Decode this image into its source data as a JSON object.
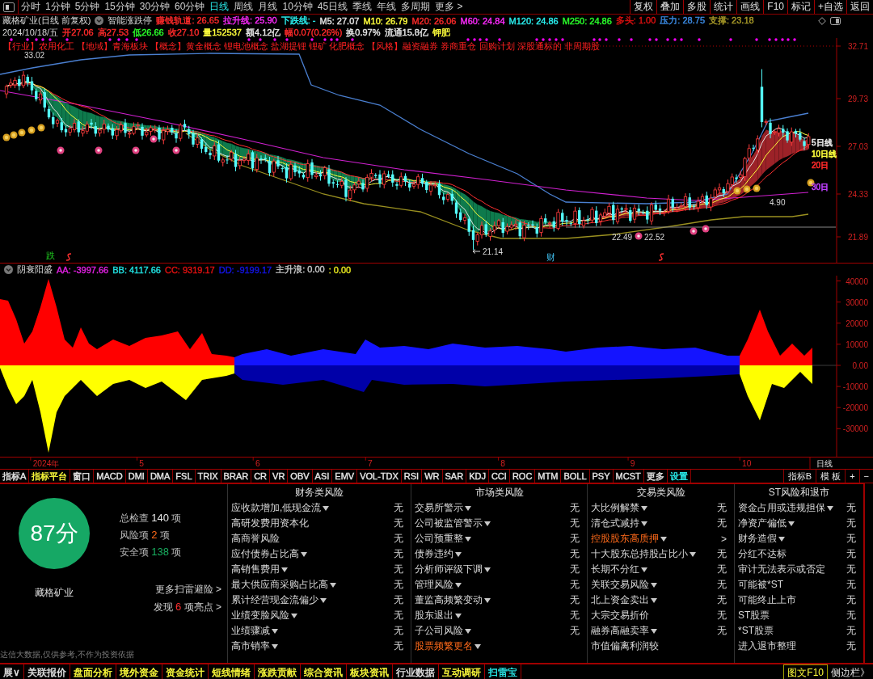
{
  "toolbar": {
    "periods": [
      {
        "label": "分时",
        "selected": false
      },
      {
        "label": "1分钟",
        "selected": false
      },
      {
        "label": "5分钟",
        "selected": false
      },
      {
        "label": "15分钟",
        "selected": false
      },
      {
        "label": "30分钟",
        "selected": false
      },
      {
        "label": "60分钟",
        "selected": false
      },
      {
        "label": "日线",
        "selected": true
      },
      {
        "label": "周线",
        "selected": false
      },
      {
        "label": "月线",
        "selected": false
      },
      {
        "label": "10分钟",
        "selected": false
      },
      {
        "label": "45日线",
        "selected": false
      },
      {
        "label": "季线",
        "selected": false
      },
      {
        "label": "年线",
        "selected": false
      },
      {
        "label": "多周期",
        "selected": false
      },
      {
        "label": "更多 >",
        "selected": false
      }
    ],
    "buttons": [
      "复权",
      "叠加",
      "多股",
      "统计",
      "画线",
      "F10",
      "标记",
      "+自选",
      "返回"
    ]
  },
  "title_line": {
    "stock": "藏格矿业(日线 前复权)",
    "indicator": "智能涨跌停",
    "values": [
      {
        "text": "赚钱轨道: 26.65",
        "color": "#ff2a2a"
      },
      {
        "text": "拉升线: 25.90",
        "color": "#ff2aff"
      },
      {
        "text": "下跌线: -",
        "color": "#2af0f0"
      },
      {
        "text": "M5: 27.07",
        "color": "#e6e6e6"
      },
      {
        "text": "M10: 26.79",
        "color": "#ffff3c"
      },
      {
        "text": "M20: 26.06",
        "color": "#ff2a2a"
      },
      {
        "text": "M60: 24.84",
        "color": "#ff2aff"
      },
      {
        "text": "M120: 24.86",
        "color": "#2af0f0"
      },
      {
        "text": "M250: 24.86",
        "color": "#2aff2a"
      },
      {
        "text": "多头: 1.00",
        "color": "#e01010"
      },
      {
        "text": "压力: 28.75",
        "color": "#3c8ce6"
      },
      {
        "text": "支撑: 23.18",
        "color": "#a89a28"
      }
    ]
  },
  "quote_line": {
    "date": "2024/10/18/五",
    "values": [
      {
        "text": "开27.06",
        "color": "#ff2a2a"
      },
      {
        "text": "高27.53",
        "color": "#ff2a2a"
      },
      {
        "text": "低26.66",
        "color": "#2aff2a"
      },
      {
        "text": "收27.10",
        "color": "#ff2a2a"
      },
      {
        "text": "量152537",
        "color": "#ffff3c"
      },
      {
        "text": "额4.12亿",
        "color": "#e6e6e6"
      },
      {
        "text": "幅0.07(0.26%)",
        "color": "#ff2a2a"
      },
      {
        "text": "换0.97%",
        "color": "#e6e6e6"
      },
      {
        "text": "流通15.8亿",
        "color": "#e6e6e6"
      },
      {
        "text": "钾肥",
        "color": "#ffff3c"
      }
    ]
  },
  "concept_line": "【行业】农用化工 【地域】青海板块 【概念】黄金概念 锂电池概念 盐湖提锂 锂矿 化肥概念 【风格】融资融券 券商重仓 回购计划 深股通标的 非周期股",
  "main_chart": {
    "price_axis": [
      "32.71",
      "29.73",
      "27.03",
      "24.33",
      "21.89"
    ],
    "price_marks": [
      "33.02",
      "21.14",
      "22.49",
      "22.52",
      "4.90"
    ],
    "ma_labels": [
      {
        "text": "5日线",
        "color": "#e6e6e6"
      },
      {
        "text": "10日线",
        "color": "#ffff3c"
      },
      {
        "text": "20日",
        "color": "#ff2a2a"
      },
      {
        "text": "30日",
        "color": "#c040ff"
      }
    ],
    "event_marks": [
      "跌",
      "财"
    ]
  },
  "indicator": {
    "name": "阴衰阳盛",
    "values": [
      {
        "text": "AA: -3997.66",
        "color": "#e020e0"
      },
      {
        "text": "BB: 4117.66",
        "color": "#20e0e0"
      },
      {
        "text": "CC: 9319.17",
        "color": "#e01010"
      },
      {
        "text": "DD: -9199.17",
        "color": "#1414e6"
      },
      {
        "text": "主升浪: 0.00",
        "color": "#c8c8c8"
      },
      {
        "text": ": 0.00",
        "color": "#e6e61e"
      }
    ],
    "axis": [
      "40000",
      "30000",
      "20000",
      "10000",
      "0.00",
      "-10000",
      "-20000",
      "-30000"
    ]
  },
  "date_axis": {
    "labels": [
      "2024年",
      "5",
      "6",
      "7",
      "8",
      "9",
      "10"
    ],
    "period": "日线"
  },
  "indicator_tabs": [
    {
      "label": "指标A",
      "color": "#e6e6e6"
    },
    {
      "label": "指标平台",
      "color": "#ffff3c"
    },
    {
      "label": "窗口",
      "color": "#e6e6e6"
    },
    {
      "label": "MACD",
      "color": "#e6e6e6"
    },
    {
      "label": "DMI",
      "color": "#e6e6e6"
    },
    {
      "label": "DMA",
      "color": "#e6e6e6"
    },
    {
      "label": "FSL",
      "color": "#e6e6e6"
    },
    {
      "label": "TRIX",
      "color": "#e6e6e6"
    },
    {
      "label": "BRAR",
      "color": "#e6e6e6"
    },
    {
      "label": "CR",
      "color": "#e6e6e6"
    },
    {
      "label": "VR",
      "color": "#e6e6e6"
    },
    {
      "label": "OBV",
      "color": "#e6e6e6"
    },
    {
      "label": "ASI",
      "color": "#e6e6e6"
    },
    {
      "label": "EMV",
      "color": "#e6e6e6"
    },
    {
      "label": "VOL-TDX",
      "color": "#e6e6e6"
    },
    {
      "label": "RSI",
      "color": "#e6e6e6"
    },
    {
      "label": "WR",
      "color": "#e6e6e6"
    },
    {
      "label": "SAR",
      "color": "#e6e6e6"
    },
    {
      "label": "KDJ",
      "color": "#e6e6e6"
    },
    {
      "label": "CCI",
      "color": "#e6e6e6"
    },
    {
      "label": "ROC",
      "color": "#e6e6e6"
    },
    {
      "label": "MTM",
      "color": "#e6e6e6"
    },
    {
      "label": "BOLL",
      "color": "#e6e6e6"
    },
    {
      "label": "PSY",
      "color": "#e6e6e6"
    },
    {
      "label": "MCST",
      "color": "#e6e6e6"
    },
    {
      "label": "更多",
      "color": "#e6e6e6"
    },
    {
      "label": "设置",
      "color": "#2af0f0"
    }
  ],
  "indicator_tools": [
    "指标B",
    "模 板",
    "+",
    "−"
  ],
  "scan_panel": {
    "score": "87分",
    "stock": "藏格矿业",
    "stats": [
      {
        "label": "总检查",
        "count": "140",
        "unit": "项",
        "kind": "total"
      },
      {
        "label": "风险项",
        "count": "2",
        "unit": "项",
        "kind": "risk"
      },
      {
        "label": "安全项",
        "count": "138",
        "unit": "项",
        "kind": "safe"
      }
    ],
    "more_link": "更多扫雷避险 >",
    "highlights": {
      "prefix": "发现",
      "count": "6",
      "suffix": "项亮点 >"
    },
    "disclaimer": "达信大数据,仅供参考,不作为投资依据",
    "columns": [
      {
        "title": "财务类风险",
        "rows": [
          {
            "name": "应收款增加,低现金流",
            "dropdown": true,
            "risk": false,
            "result": "无"
          },
          {
            "name": "高研发费用资本化",
            "dropdown": false,
            "risk": false,
            "result": "无"
          },
          {
            "name": "高商誉风险",
            "dropdown": false,
            "risk": false,
            "result": "无"
          },
          {
            "name": "应付债券占比高",
            "dropdown": true,
            "risk": false,
            "result": "无"
          },
          {
            "name": "高销售费用",
            "dropdown": true,
            "risk": false,
            "result": "无"
          },
          {
            "name": "最大供应商采购占比高",
            "dropdown": true,
            "risk": false,
            "result": "无"
          },
          {
            "name": "累计经营现金流偏少",
            "dropdown": true,
            "risk": false,
            "result": "无"
          },
          {
            "name": "业绩变脸风险",
            "dropdown": true,
            "risk": false,
            "result": "无"
          },
          {
            "name": "业绩骤减",
            "dropdown": true,
            "risk": false,
            "result": "无"
          },
          {
            "name": "高市销率",
            "dropdown": true,
            "risk": false,
            "result": "无"
          }
        ]
      },
      {
        "title": "市场类风险",
        "rows": [
          {
            "name": "交易所警示",
            "dropdown": true,
            "risk": false,
            "result": "无"
          },
          {
            "name": "公司被监管警示",
            "dropdown": true,
            "risk": false,
            "result": "无"
          },
          {
            "name": "公司预重整",
            "dropdown": true,
            "risk": false,
            "result": "无"
          },
          {
            "name": "债券违约",
            "dropdown": true,
            "risk": false,
            "result": "无"
          },
          {
            "name": "分析师评级下调",
            "dropdown": true,
            "risk": false,
            "result": "无"
          },
          {
            "name": "管理风险",
            "dropdown": true,
            "risk": false,
            "result": "无"
          },
          {
            "name": "董监高频繁变动",
            "dropdown": true,
            "risk": false,
            "result": "无"
          },
          {
            "name": "股东退出",
            "dropdown": true,
            "risk": false,
            "result": "无"
          },
          {
            "name": "子公司风险",
            "dropdown": true,
            "risk": false,
            "result": "无"
          },
          {
            "name": "股票频繁更名",
            "dropdown": true,
            "risk": true
          }
        ]
      },
      {
        "title": "交易类风险",
        "rows": [
          {
            "name": "大比例解禁",
            "dropdown": true,
            "risk": false,
            "result": "无"
          },
          {
            "name": "清仓式减持",
            "dropdown": true,
            "risk": false,
            "result": "无"
          },
          {
            "name": "控股股东高质押",
            "dropdown": true,
            "risk": true,
            "result": ">"
          },
          {
            "name": "十大股东总持股占比小",
            "dropdown": true,
            "risk": false,
            "result": "无"
          },
          {
            "name": "长期不分红",
            "dropdown": true,
            "risk": false,
            "result": "无"
          },
          {
            "name": "关联交易风险",
            "dropdown": true,
            "risk": false,
            "result": "无"
          },
          {
            "name": "北上资金卖出",
            "dropdown": true,
            "risk": false,
            "result": "无"
          },
          {
            "name": "大宗交易折价",
            "dropdown": false,
            "risk": false,
            "result": "无"
          },
          {
            "name": "融券高融卖率",
            "dropdown": true,
            "risk": false,
            "result": "无"
          },
          {
            "name": "市值偏离利润较",
            "dropdown": false,
            "risk": false
          }
        ]
      },
      {
        "title": "ST风险和退市",
        "rows": [
          {
            "name": "资金占用或违规担保",
            "dropdown": true,
            "risk": false,
            "result": "无"
          },
          {
            "name": "净资产偏低",
            "dropdown": true,
            "risk": false,
            "result": "无"
          },
          {
            "name": "财务造假",
            "dropdown": true,
            "risk": false,
            "result": "无"
          },
          {
            "name": "分红不达标",
            "dropdown": false,
            "risk": false,
            "result": "无"
          },
          {
            "name": "审计无法表示或否定",
            "dropdown": false,
            "risk": false,
            "result": "无"
          },
          {
            "name": "可能被*ST",
            "dropdown": false,
            "risk": false,
            "result": "无"
          },
          {
            "name": "可能终止上市",
            "dropdown": false,
            "risk": false,
            "result": "无"
          },
          {
            "name": "ST股票",
            "dropdown": false,
            "risk": false,
            "result": "无"
          },
          {
            "name": "*ST股票",
            "dropdown": false,
            "risk": false,
            "result": "无"
          },
          {
            "name": "进入退市整理",
            "dropdown": false,
            "risk": false,
            "result": "无"
          }
        ]
      }
    ]
  },
  "bottom_tabs": [
    {
      "label": "展∨",
      "color": "#e6e6e6",
      "selected": false
    },
    {
      "label": "关联报价",
      "color": "#e6e6e6",
      "selected": false
    },
    {
      "label": "盘面分析",
      "color": "#ffff3c",
      "selected": false
    },
    {
      "label": "境外资金",
      "color": "#ffff3c",
      "selected": false
    },
    {
      "label": "资金统计",
      "color": "#ffff3c",
      "selected": false
    },
    {
      "label": "短线情绪",
      "color": "#ffff3c",
      "selected": false
    },
    {
      "label": "涨跌贡献",
      "color": "#ffff3c",
      "selected": false
    },
    {
      "label": "综合资讯",
      "color": "#ffff3c",
      "selected": false
    },
    {
      "label": "板块资讯",
      "color": "#ffff3c",
      "selected": false
    },
    {
      "label": "行业数据",
      "color": "#e6e6e6",
      "selected": false
    },
    {
      "label": "互动调研",
      "color": "#ffff3c",
      "selected": false
    },
    {
      "label": "扫雷宝",
      "selected": true
    }
  ],
  "bottom_right": [
    "图文F10",
    "侧边栏》"
  ]
}
